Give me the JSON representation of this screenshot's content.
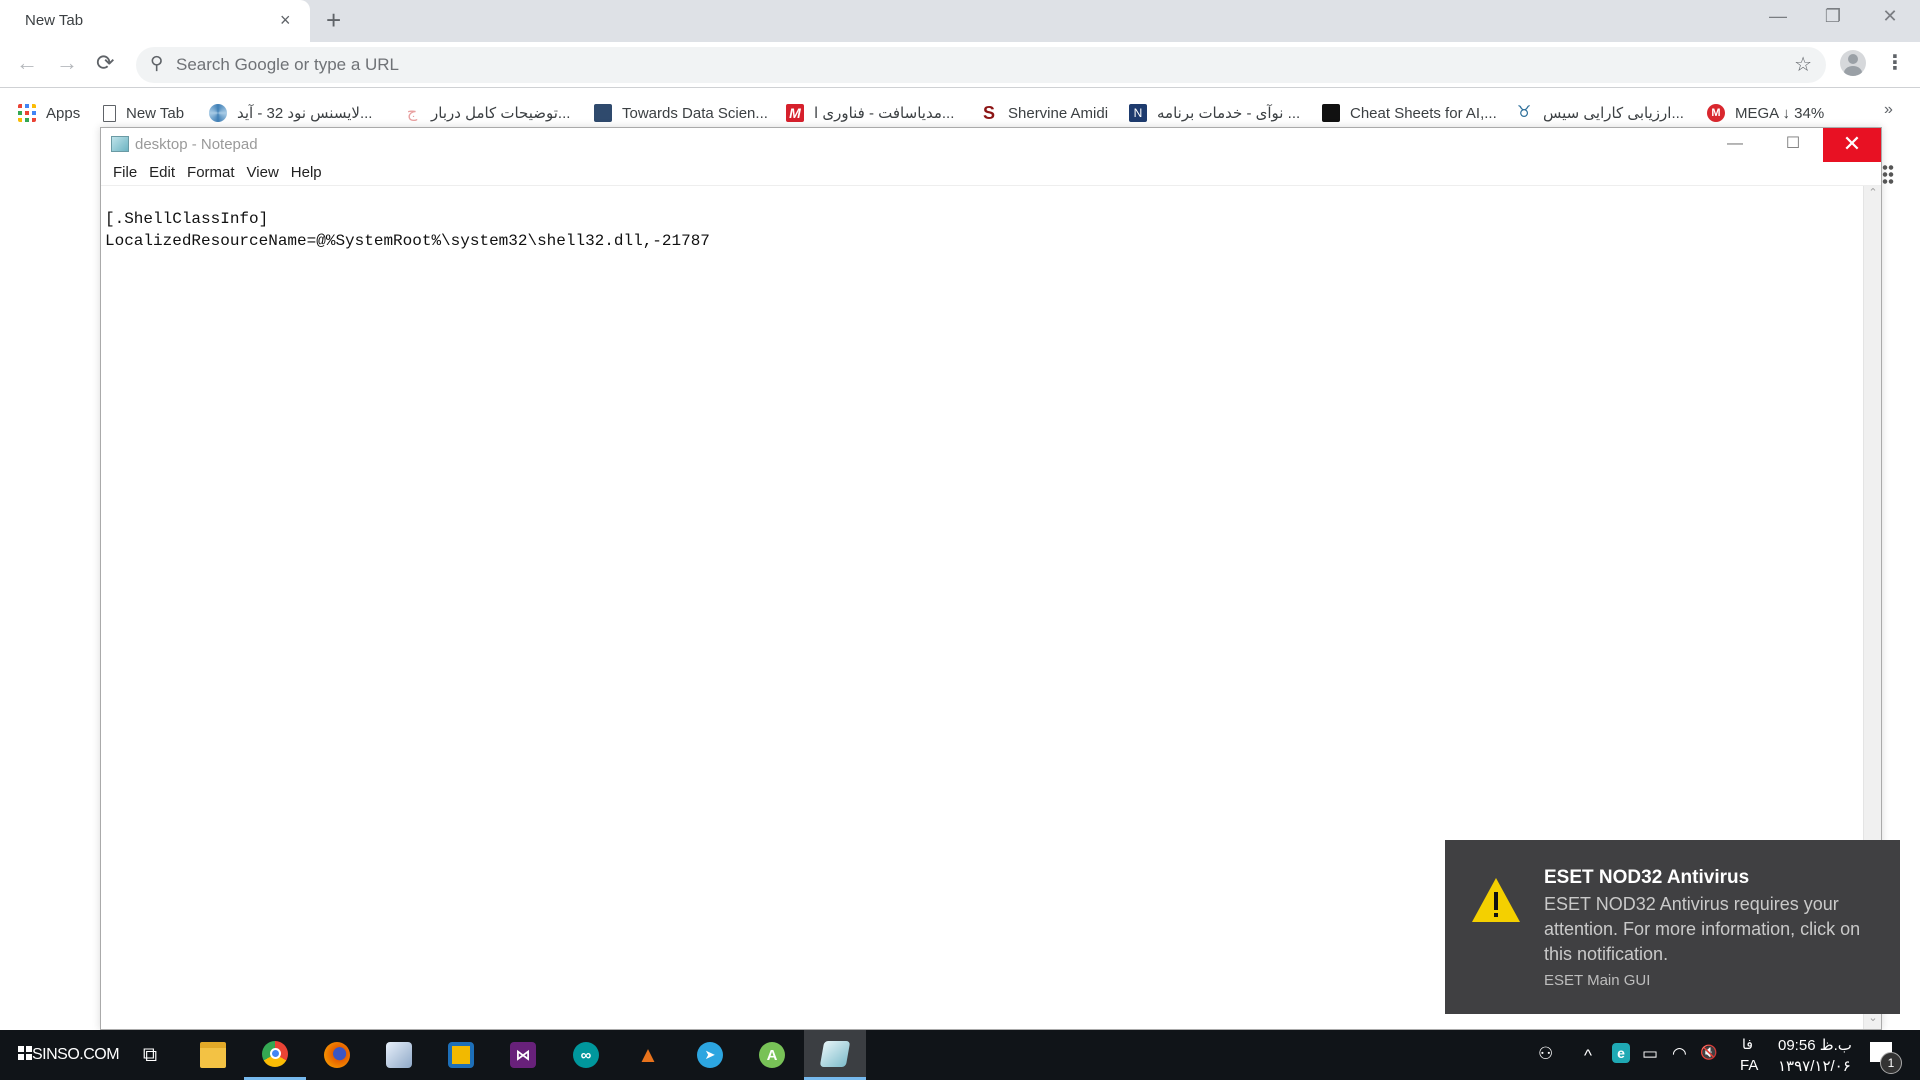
{
  "browser": {
    "tab": {
      "title": "New Tab",
      "close_label": "×"
    },
    "new_tab_label": "+",
    "window_controls": {
      "minimize": "—",
      "restore": "❐",
      "close": "✕"
    },
    "nav": {
      "back": "←",
      "forward": "→",
      "reload": "⟳"
    },
    "omnibox": {
      "placeholder": "Search Google or type a URL",
      "value": ""
    },
    "star_icon": "☆",
    "menu_icon": "⋮",
    "bookmarks": [
      {
        "label": "Apps",
        "icon": "apps-grid-icon",
        "color": "#ea4335"
      },
      {
        "label": "New Tab",
        "icon": "page-icon",
        "color": "#5f6368"
      },
      {
        "label": "لایسنس نود 32 - آید...",
        "icon": "aperture-icon",
        "color": "#3f7fb6"
      },
      {
        "label": "توضیحات کامل دربار...",
        "icon": "calligraphy-icon",
        "color": "#e8a0a0"
      },
      {
        "label": "Towards Data Scien...",
        "icon": "tds-icon",
        "color": "#2f4a6d"
      },
      {
        "label": "مدیاسافت - فناوری ا...",
        "icon": "m-logo-icon",
        "color": "#d6202c"
      },
      {
        "label": "Shervine Amidi",
        "icon": "stanford-icon",
        "color": "#8c1515"
      },
      {
        "label": "نوآی - خدمات برنامه ...",
        "icon": "n-logo-icon",
        "color": "#1e3b6e"
      },
      {
        "label": "Cheat Sheets for AI,...",
        "icon": "cheatsheet-icon",
        "color": "#111111"
      },
      {
        "label": "ارزیابی کارایی سیس...",
        "icon": "ribbon-icon",
        "color": "#2d6f9a"
      },
      {
        "label": "MEGA ↓ 34%",
        "icon": "mega-icon",
        "color": "#d9272e"
      }
    ],
    "more_bookmarks": "»"
  },
  "notepad": {
    "title": "desktop - Notepad",
    "controls": {
      "minimize": "—",
      "maximize": "☐",
      "close": "✕"
    },
    "menu": [
      "File",
      "Edit",
      "Format",
      "View",
      "Help"
    ],
    "content": "[.ShellClassInfo]\nLocalizedResourceName=@%SystemRoot%\\system32\\shell32.dll,-21787",
    "scroll_up": "⌃",
    "scroll_down": "⌄"
  },
  "toast": {
    "title": "ESET NOD32 Antivirus",
    "body": "ESET NOD32 Antivirus requires your attention. For more information, click on this notification.",
    "source": "ESET Main GUI",
    "warning_color": "#f4d000"
  },
  "taskbar": {
    "start_label": "SINSO.COM",
    "apps": [
      {
        "name": "task-view",
        "glyph": "⧉",
        "bg": "transparent"
      },
      {
        "name": "file-explorer",
        "glyph": "",
        "bg": "#f3c244"
      },
      {
        "name": "chrome",
        "glyph": "",
        "bg": "#4285f4"
      },
      {
        "name": "firefox",
        "glyph": "",
        "bg": "#e66000"
      },
      {
        "name": "virtualbox",
        "glyph": "",
        "bg": "#a9c4e0"
      },
      {
        "name": "vmware",
        "glyph": "",
        "bg": "#f2b900"
      },
      {
        "name": "visual-studio",
        "glyph": "⋈",
        "bg": "#68217a"
      },
      {
        "name": "arduino",
        "glyph": "∞",
        "bg": "#00979c"
      },
      {
        "name": "matlab",
        "glyph": "▲",
        "bg": "transparent"
      },
      {
        "name": "telegram",
        "glyph": "➤",
        "bg": "#2ca5e0"
      },
      {
        "name": "android-studio",
        "glyph": "A",
        "bg": "#78c257"
      },
      {
        "name": "notepad",
        "glyph": "",
        "bg": "#9fd1dc"
      }
    ],
    "tray": {
      "people": "⚇",
      "chevron": "^",
      "eset": "e",
      "battery": "▭",
      "wifi": "◠",
      "volume": "🔇"
    },
    "lang_top": "فا",
    "lang_bottom": "FA",
    "time": "ب.ظ 09:56",
    "date": "۱۳۹۷/۱۲/۰۶",
    "notifications_count": "1"
  }
}
